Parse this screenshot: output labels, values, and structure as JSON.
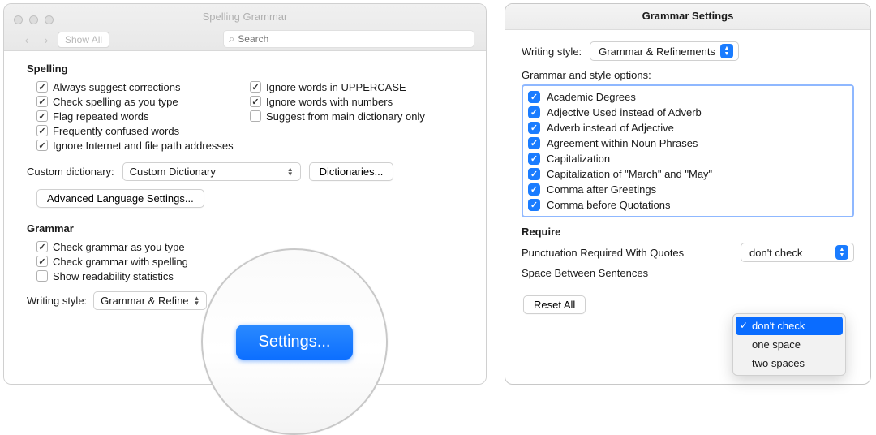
{
  "left": {
    "titlebar": {
      "title": "Spelling  Grammar",
      "show_all": "Show All",
      "search_placeholder": "Search"
    },
    "spelling": {
      "heading": "Spelling",
      "col1": [
        {
          "label": "Always suggest corrections",
          "checked": true
        },
        {
          "label": "Check spelling as you type",
          "checked": true
        },
        {
          "label": "Flag repeated words",
          "checked": true
        },
        {
          "label": "Frequently confused words",
          "checked": true
        },
        {
          "label": "Ignore Internet and file path addresses",
          "checked": true
        }
      ],
      "col2": [
        {
          "label": "Ignore words in UPPERCASE",
          "checked": true
        },
        {
          "label": "Ignore words with numbers",
          "checked": true
        },
        {
          "label": "Suggest from main dictionary only",
          "checked": false
        }
      ],
      "custom_dict_label": "Custom dictionary:",
      "custom_dict_value": "Custom Dictionary",
      "dictionaries_btn": "Dictionaries...",
      "advanced_btn": "Advanced Language Settings..."
    },
    "grammar": {
      "heading": "Grammar",
      "items": [
        {
          "label": "Check grammar as you type",
          "checked": true
        },
        {
          "label": "Check grammar with spelling",
          "checked": true
        },
        {
          "label": "Show readability statistics",
          "checked": false
        }
      ],
      "writing_style_label": "Writing style:",
      "writing_style_value": "Grammar & Refine",
      "settings_btn": "Settings..."
    }
  },
  "lens": {
    "settings_btn": "Settings..."
  },
  "right": {
    "title": "Grammar Settings",
    "writing_style_label": "Writing style:",
    "writing_style_value": "Grammar & Refinements",
    "options_label": "Grammar and style options:",
    "options": [
      "Academic Degrees",
      "Adjective Used instead of Adverb",
      "Adverb instead of Adjective",
      "Agreement within Noun Phrases",
      "Capitalization",
      "Capitalization of \"March\" and \"May\"",
      "Comma after Greetings",
      "Comma before Quotations"
    ],
    "require_heading": "Require",
    "punct_label": "Punctuation Required With Quotes",
    "punct_value": "don't check",
    "space_label": "Space Between Sentences",
    "reset_btn": "Reset All",
    "popup": {
      "selected": "don't check",
      "items": [
        "don't check",
        "one space",
        "two spaces"
      ]
    }
  }
}
